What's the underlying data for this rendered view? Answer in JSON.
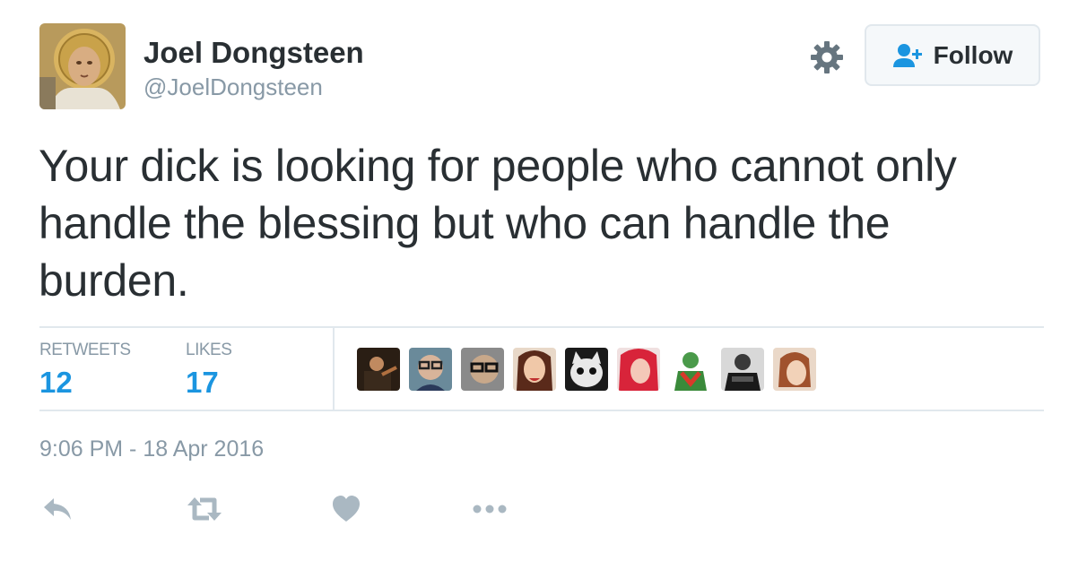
{
  "user": {
    "name": "Joel Dongsteen",
    "handle": "@JoelDongsteen"
  },
  "follow_button": {
    "label": "Follow"
  },
  "tweet": {
    "lines": [
      "Your dick is looking for people who cannot only",
      "handle the blessing but who can handle the",
      "burden."
    ]
  },
  "stats": {
    "retweets_label": "RETWEETS",
    "retweets_count": "12",
    "likes_label": "LIKES",
    "likes_count": "17"
  },
  "timestamp": "9:06 PM - 18 Apr 2016",
  "colors": {
    "accent": "#1b95e0",
    "text": "#292f33",
    "muted": "#8899a6",
    "border": "#e1e8ed"
  },
  "icons": [
    "settings-gear-icon",
    "follow-user-icon",
    "reply-icon",
    "retweet-icon",
    "like-heart-icon",
    "more-dots-icon"
  ]
}
